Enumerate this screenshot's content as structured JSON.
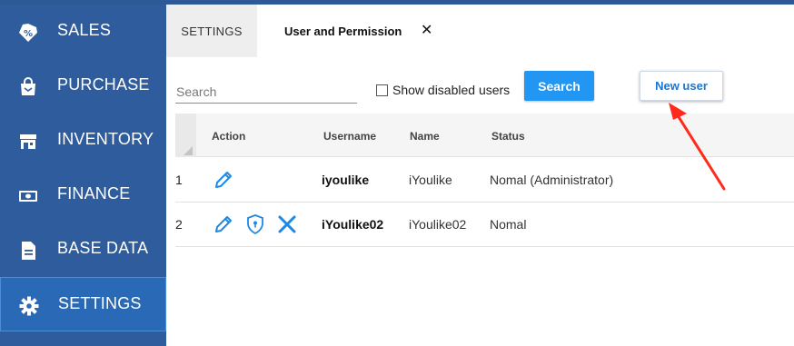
{
  "sidebar": {
    "items": [
      {
        "label": "SALES",
        "icon": "sales-tag-icon"
      },
      {
        "label": "PURCHASE",
        "icon": "shopping-bag-icon"
      },
      {
        "label": "INVENTORY",
        "icon": "store-icon"
      },
      {
        "label": "FINANCE",
        "icon": "money-icon"
      },
      {
        "label": "BASE DATA",
        "icon": "document-icon"
      },
      {
        "label": "SETTINGS",
        "icon": "gear-icon",
        "active": true
      }
    ]
  },
  "tabs": {
    "settings_label": "SETTINGS",
    "active_label": "User and Permission",
    "close_glyph": "✕"
  },
  "filters": {
    "search_placeholder": "Search",
    "show_disabled_label": "Show disabled users",
    "show_disabled_checked": false,
    "search_button": "Search",
    "new_user_button": "New user"
  },
  "table": {
    "columns": [
      "Action",
      "Username",
      "Name",
      "Status"
    ],
    "rows": [
      {
        "num": "1",
        "username": "iyoulike",
        "name": "iYoulike",
        "status": "Nomal (Administrator)",
        "actions": [
          "edit-pencil-icon"
        ]
      },
      {
        "num": "2",
        "username": "iYoulike02",
        "name": "iYoulike02",
        "status": "Nomal",
        "actions": [
          "edit-pencil-icon",
          "permission-shield-icon",
          "delete-x-icon"
        ]
      }
    ]
  },
  "colors": {
    "sidebar_bg": "#2f5c9d",
    "sidebar_active": "#2a69b6",
    "primary": "#2196f3",
    "link": "#1976d2",
    "annotation_arrow": "#ff2a1a"
  }
}
